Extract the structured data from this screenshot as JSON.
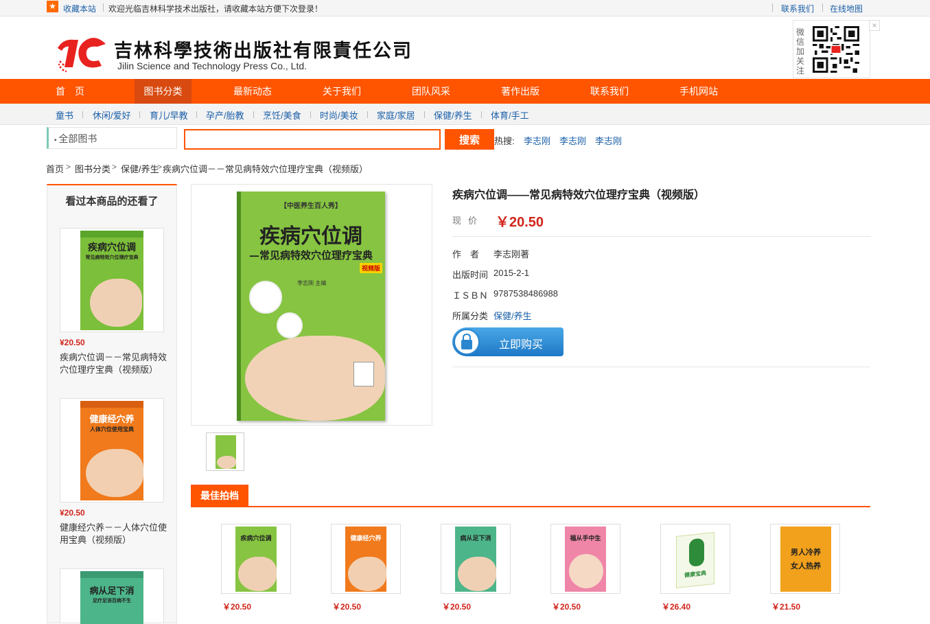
{
  "topbar": {
    "favorite": "收藏本站",
    "welcome": "欢迎光临吉林科学技术出版社，请收藏本站方便下次登录！",
    "contact": "联系我们",
    "sitemap": "在线地图"
  },
  "header": {
    "logo_cn": "吉林科學技術出版社有限責任公司",
    "logo_en": "Jilin Science and Technology Press  Co., Ltd.",
    "wechat_label": "微信加关注",
    "close": "×"
  },
  "nav": {
    "items": [
      "首　页",
      "图书分类",
      "最新动态",
      "关于我们",
      "团队风采",
      "著作出版",
      "联系我们",
      "手机网站"
    ]
  },
  "subnav": {
    "items": [
      "童书",
      "休闲/爱好",
      "育儿/早教",
      "孕产/胎教",
      "烹饪/美食",
      "时尚/美妆",
      "家庭/家居",
      "保健/养生",
      "体育/手工"
    ]
  },
  "search": {
    "all_books": "全部图书",
    "placeholder": "",
    "button": "搜索",
    "hot_label": "热搜:",
    "hot": [
      "李志刚",
      "李志刚",
      "李志刚"
    ]
  },
  "breadcrumb": [
    "首页",
    "图书分类",
    "保健/养生",
    "疾病穴位调－－常见病特效穴位理疗宝典（视频版）"
  ],
  "sidebar": {
    "title": "看过本商品的还看了",
    "items": [
      {
        "price": "¥20.50",
        "name": "疾病穴位调－－常见病特效穴位理疗宝典（视频版）",
        "cover_title": "疾病穴位调",
        "cover_sub": "常见病特效穴位理疗宝典"
      },
      {
        "price": "¥20.50",
        "name": "健康经穴养－－人体穴位使用宝典（视频版）",
        "cover_title": "健康经穴养",
        "cover_sub": "人体穴位使用宝典"
      },
      {
        "cover_title": "病从足下消",
        "cover_sub": "足疗足浴百病不生"
      }
    ]
  },
  "product": {
    "title": "疾病穴位调——常见病特效穴位理疗宝典（视频版）",
    "price_label": "现价",
    "price": "￥20.50",
    "author_label": "作　者",
    "author": "李志刚著",
    "date_label": "出版时间",
    "date": "2015-2-1",
    "isbn_label": "ＩＳＢＮ",
    "isbn": "9787538486988",
    "category_label": "所属分类",
    "category": "保健/养生",
    "buy": "立即购买",
    "cover_series": "【中医养生百人秀】",
    "cover_title": "疾病穴位调",
    "cover_sub": "—常见病特效穴位理疗宝典",
    "cover_badge": "视频版",
    "cover_author": "李志刚 主编"
  },
  "best": {
    "tab": "最佳拍档",
    "items": [
      {
        "price": "￥20.50",
        "cover": "疾病穴位调"
      },
      {
        "price": "￥20.50",
        "cover": "健康经穴养"
      },
      {
        "price": "￥20.50",
        "cover": "病从足下消"
      },
      {
        "price": "￥20.50",
        "cover": "福从手中生"
      },
      {
        "price": "￥26.40",
        "cover": "健康宝典"
      },
      {
        "price": "￥21.50",
        "cover": "男人冷养 女人热养"
      }
    ]
  },
  "colors": {
    "accent": "#ff5400",
    "link": "#1a5fa8",
    "price": "#d0251b"
  }
}
